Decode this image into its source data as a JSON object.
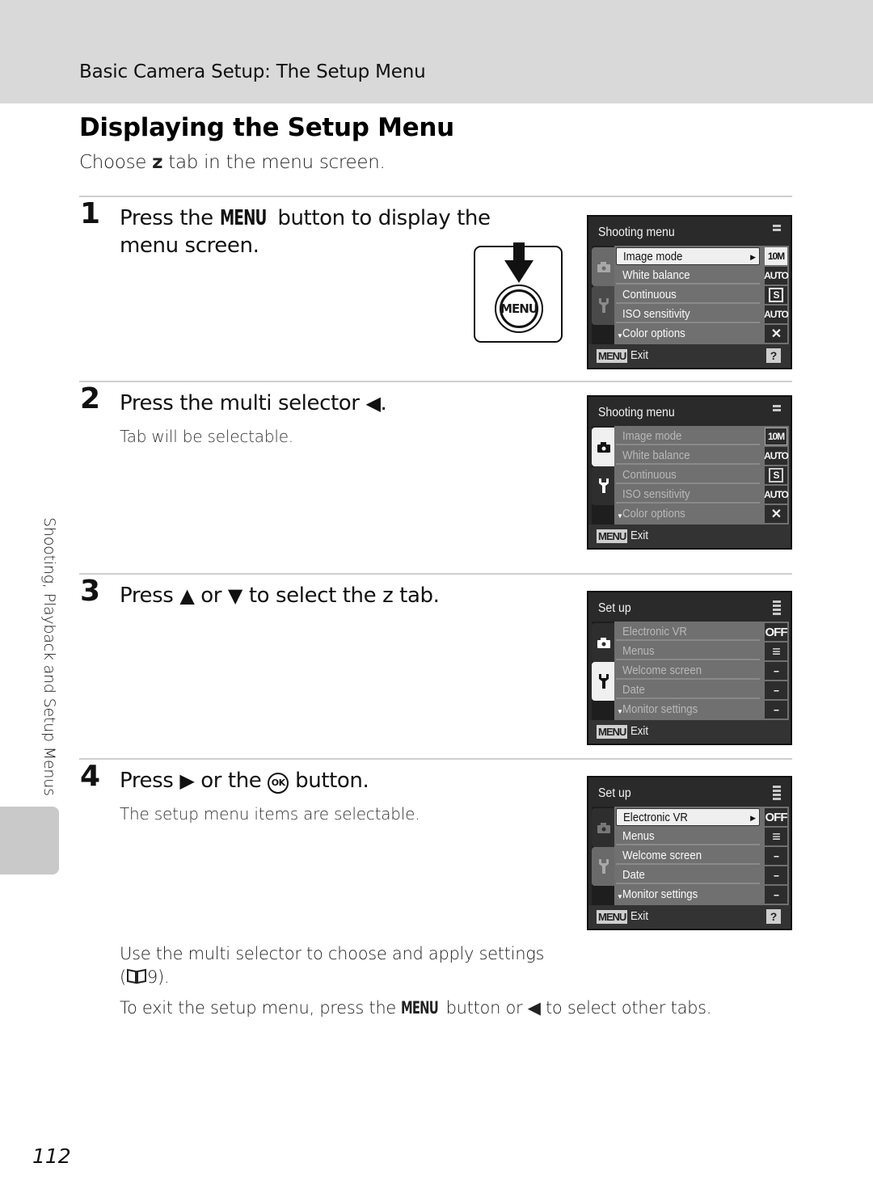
{
  "header": {
    "section_title": "Basic Camera Setup: The Setup Menu"
  },
  "page": {
    "title": "Displaying the Setup Menu",
    "intro": {
      "before": "Choose",
      "tab_glyph": "z",
      "after": "tab in the menu screen."
    },
    "side_label": "Shooting, Playback and Setup Menus",
    "page_number": "112"
  },
  "steps": [
    {
      "number": "1",
      "text_before": "Press the",
      "menu_word": "MENU",
      "text_after": "button to display the",
      "text_line2": "menu screen.",
      "button_illustration": {
        "label": "MENU",
        "icon": "arrow-down-icon"
      }
    },
    {
      "number": "2",
      "text_before": "Press the multi selector",
      "glyph": "◀",
      "text_after": ".",
      "subtext": "Tab will be selectable."
    },
    {
      "number": "3",
      "text_before": "Press",
      "glyph_up": "▲",
      "text_mid": "or",
      "glyph_down": "▼",
      "text_after": "to select the z  tab."
    },
    {
      "number": "4",
      "text_before": "Press",
      "glyph": "▶",
      "text_mid": "or the",
      "ok_label": "OK",
      "text_after": "button.",
      "subtext": "The setup menu items are selectable."
    }
  ],
  "screens": [
    {
      "title": "Shooting menu",
      "active_tab": "shooting",
      "items": [
        {
          "label": "Image mode",
          "value": "10M",
          "selected": true
        },
        {
          "label": "White balance",
          "value": "AUTO"
        },
        {
          "label": "Continuous",
          "value": "S"
        },
        {
          "label": "ISO sensitivity",
          "value": "AUTO"
        },
        {
          "label": "Color options",
          "value": "✕"
        }
      ],
      "footer": {
        "menu": "MENU",
        "exit": "Exit",
        "help": "?"
      }
    },
    {
      "title": "Shooting menu",
      "active_tab": "shooting-highlighted",
      "items": [
        {
          "label": "Image mode",
          "value": "10M"
        },
        {
          "label": "White balance",
          "value": "AUTO"
        },
        {
          "label": "Continuous",
          "value": "S"
        },
        {
          "label": "ISO sensitivity",
          "value": "AUTO"
        },
        {
          "label": "Color options",
          "value": "✕"
        }
      ],
      "footer": {
        "menu": "MENU",
        "exit": "Exit"
      }
    },
    {
      "title": "Set up",
      "active_tab": "setup-highlighted",
      "items": [
        {
          "label": "Electronic VR",
          "value": "OFF"
        },
        {
          "label": "Menus",
          "value": "≡"
        },
        {
          "label": "Welcome screen",
          "value": "--"
        },
        {
          "label": "Date",
          "value": "--"
        },
        {
          "label": "Monitor settings",
          "value": "--"
        }
      ],
      "footer": {
        "menu": "MENU",
        "exit": "Exit"
      }
    },
    {
      "title": "Set up",
      "active_tab": "setup",
      "items": [
        {
          "label": "Electronic VR",
          "value": "OFF",
          "selected": true
        },
        {
          "label": "Menus",
          "value": "≡"
        },
        {
          "label": "Welcome screen",
          "value": "--"
        },
        {
          "label": "Date",
          "value": "--"
        },
        {
          "label": "Monitor settings",
          "value": "--"
        }
      ],
      "footer": {
        "menu": "MENU",
        "exit": "Exit",
        "help": "?"
      }
    }
  ],
  "notes": {
    "line1": "Use the multi selector to choose and apply settings",
    "line2_ref_open": "(",
    "line2_ref_icon": "book-icon",
    "line2_ref_page": "9).",
    "line3_before": "To exit the setup menu, press the",
    "line3_menu": "MENU",
    "line3_mid": "button or",
    "line3_glyph": "◀",
    "line3_after": "to select other tabs."
  }
}
